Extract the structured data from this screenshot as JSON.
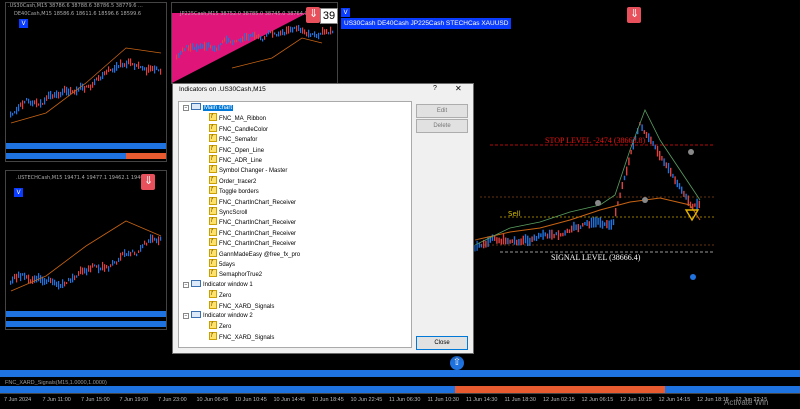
{
  "mini_charts": [
    {
      "title": ".US30Cash,M15  38786.6 38788.6 38786.5 38779.6 ...",
      "badge": "V"
    },
    {
      "title": "DE40Cash,M15  18586.6 18611.6 18596.6 18599.6",
      "badge": "V"
    },
    {
      "title": "JP225Cash,M15  38752.0 38785.0 38745.0 38764.0",
      "badge": "V",
      "counter": "39"
    },
    {
      "title": ".USTECHCash,M15  19471.4 19477.1 19462.1 19466.1",
      "badge": "V"
    }
  ],
  "symbols": [
    "US30Cash",
    "DE40Cash",
    "JP225Cash",
    "STECHCas",
    "XAUUSD"
  ],
  "main_chart": {
    "stop_level": "STOP LEVEL -2474 (38663.8)",
    "signal_level": "SIGNAL LEVEL (38666.4)",
    "signal_text": "Sell"
  },
  "subwindow_label": "FNC_XARD_Signals(M15,1.0000,1.0000)",
  "time_axis": [
    "7 Jun 2024",
    "7 Jun 11:00",
    "7 Jun 15:00",
    "7 Jun 19:00",
    "7 Jun 23:00",
    "10 Jun 06:45",
    "10 Jun 10:45",
    "10 Jun 14:45",
    "10 Jun 18:45",
    "10 Jun 22:45",
    "11 Jun 06:30",
    "11 Jun 10:30",
    "11 Jun 14:30",
    "11 Jun 18:30",
    "12 Jun 02:15",
    "12 Jun 06:15",
    "12 Jun 10:15",
    "12 Jun 14:15",
    "12 Jun 18:15",
    "12 Jun 22:15"
  ],
  "watermark": "Activate Win",
  "dialog": {
    "title": "Indicators on .US30Cash,M15",
    "help": "?",
    "close_x": "✕",
    "edit": "Edit",
    "delete": "Delete",
    "close_button": "Close",
    "tree": [
      {
        "kind": "window",
        "label": "Main chart",
        "selected": true,
        "children": [
          "FNC_MA_Ribbon",
          "FNC_CandleColor",
          "FNC_Semafor",
          "FNC_Open_Line",
          "FNC_ADR_Line",
          "Symbol Changer - Master",
          "Order_tracer2",
          "Toggle borders",
          "FNC_ChartInChart_Receiver",
          "SyncScroll",
          "FNC_ChartInChart_Receiver",
          "FNC_ChartInChart_Receiver",
          "FNC_ChartInChart_Receiver",
          "GannMadeEasy @free_fx_pro",
          "5days",
          "SemaphorTrue2"
        ]
      },
      {
        "kind": "window",
        "label": "Indicator window 1",
        "selected": false,
        "children": [
          "Zero",
          "FNC_XARD_Signals"
        ]
      },
      {
        "kind": "window",
        "label": "Indicator window 2",
        "selected": false,
        "children": [
          "Zero",
          "FNC_XARD_Signals"
        ]
      }
    ]
  }
}
